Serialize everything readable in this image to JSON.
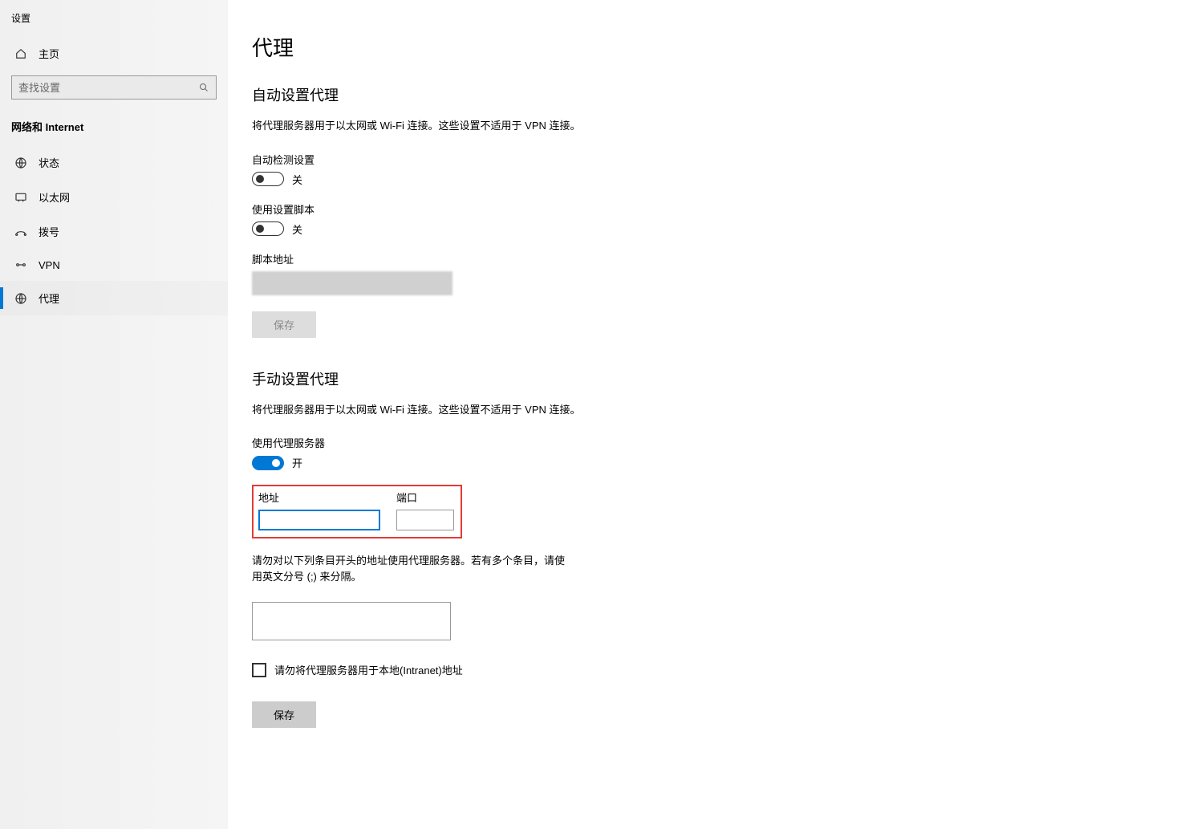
{
  "app_title": "设置",
  "sidebar": {
    "home_label": "主页",
    "search_placeholder": "查找设置",
    "section_label": "网络和 Internet",
    "items": [
      {
        "label": "状态",
        "icon": "status-icon"
      },
      {
        "label": "以太网",
        "icon": "ethernet-icon"
      },
      {
        "label": "拨号",
        "icon": "dialup-icon"
      },
      {
        "label": "VPN",
        "icon": "vpn-icon"
      },
      {
        "label": "代理",
        "icon": "proxy-icon"
      }
    ],
    "selected_index": 4
  },
  "main": {
    "page_title": "代理",
    "auto": {
      "section_title": "自动设置代理",
      "desc": "将代理服务器用于以太网或 Wi-Fi 连接。这些设置不适用于 VPN 连接。",
      "auto_detect_label": "自动检测设置",
      "auto_detect_state": "关",
      "use_script_label": "使用设置脚本",
      "use_script_state": "关",
      "script_url_label": "脚本地址",
      "save_label": "保存"
    },
    "manual": {
      "section_title": "手动设置代理",
      "desc": "将代理服务器用于以太网或 Wi-Fi 连接。这些设置不适用于 VPN 连接。",
      "use_proxy_label": "使用代理服务器",
      "use_proxy_state": "开",
      "address_label": "地址",
      "address_value": "",
      "port_label": "端口",
      "port_value": "",
      "exclude_desc": "请勿对以下列条目开头的地址使用代理服务器。若有多个条目，请使用英文分号 (;) 来分隔。",
      "exclude_value": "",
      "local_bypass_label": "请勿将代理服务器用于本地(Intranet)地址",
      "local_bypass_checked": false,
      "save_label": "保存"
    }
  }
}
